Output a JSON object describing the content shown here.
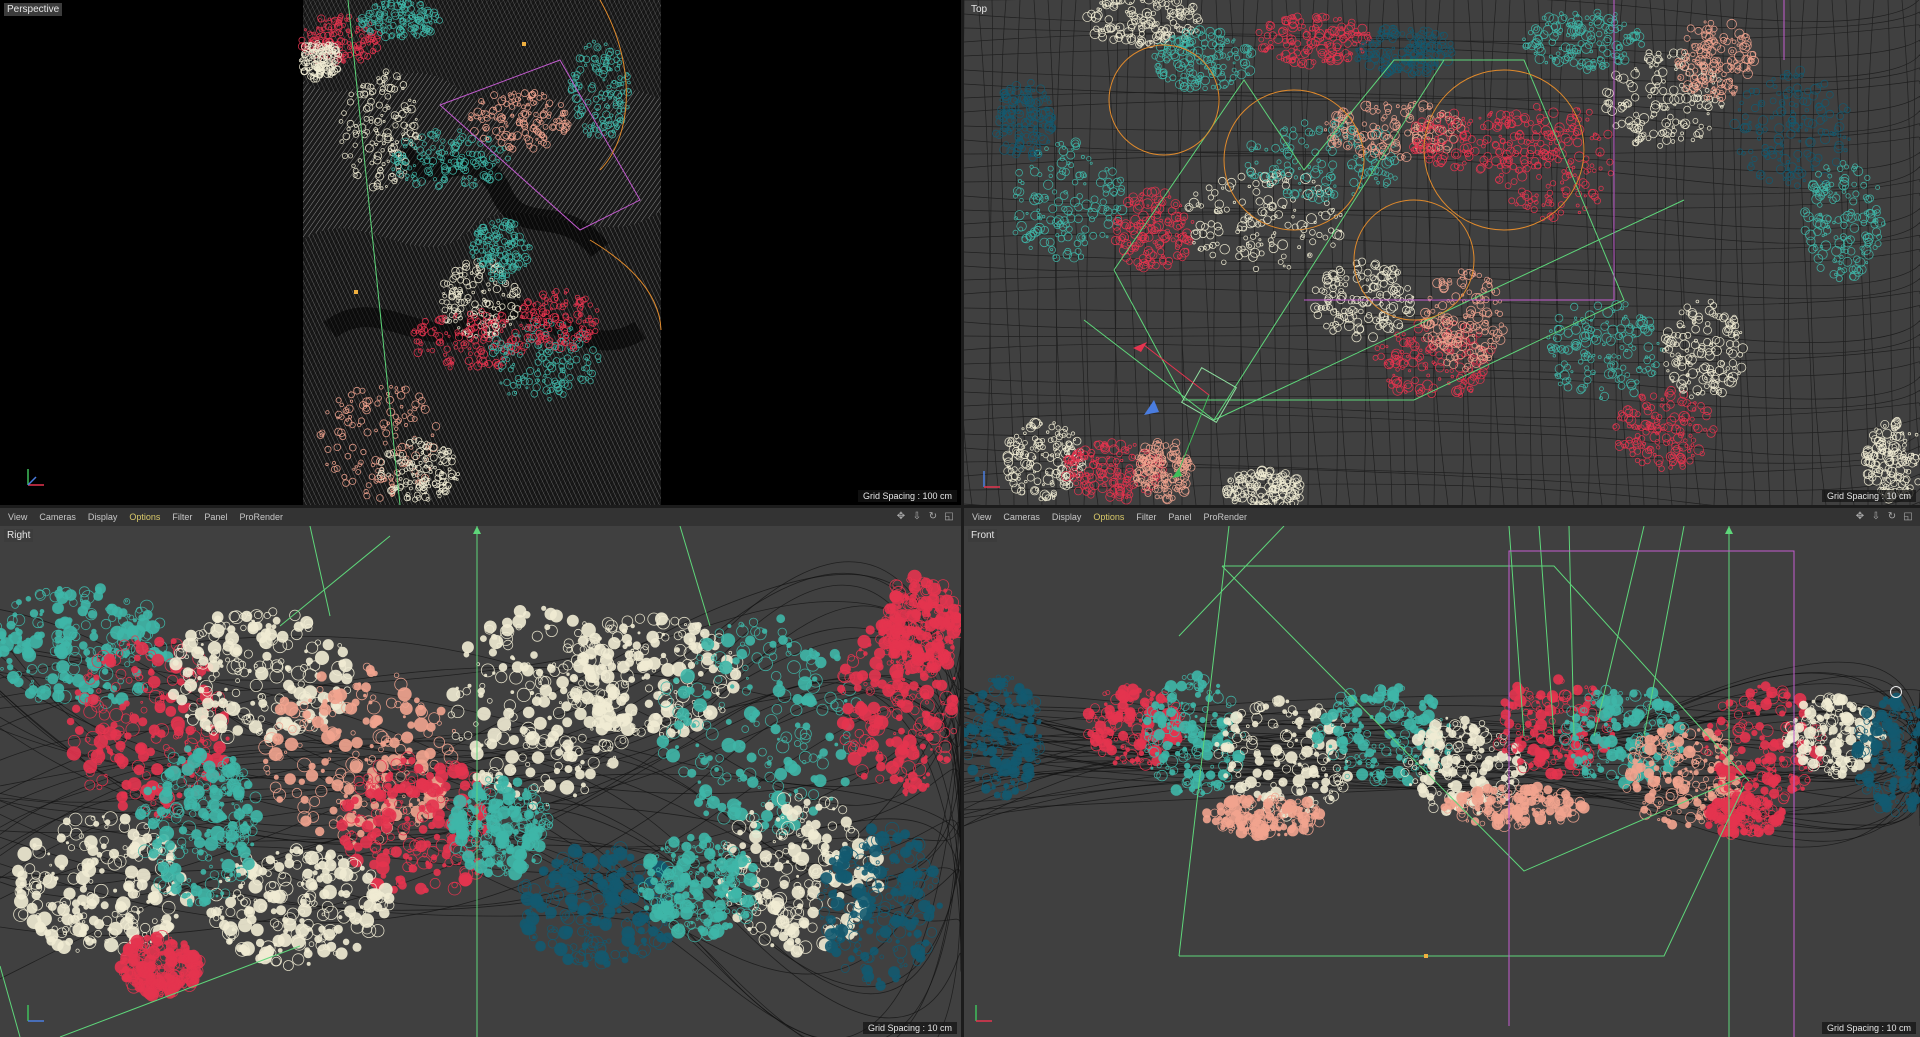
{
  "viewports": {
    "perspective": {
      "label": "Perspective",
      "grid": "Grid Spacing : 100 cm"
    },
    "top": {
      "label": "Top",
      "grid": "Grid Spacing : 10 cm"
    },
    "right": {
      "label": "Right",
      "grid": "Grid Spacing : 10 cm"
    },
    "front": {
      "label": "Front",
      "grid": "Grid Spacing : 10 cm"
    }
  },
  "menu": {
    "items": [
      "View",
      "Cameras",
      "Display",
      "Options",
      "Filter",
      "Panel",
      "ProRender"
    ],
    "active": "Options"
  },
  "icons": [
    "move-icon",
    "zoom-icon",
    "rotate-icon",
    "maximize-icon",
    "crosshair-icon"
  ],
  "colors": {
    "red": "#e5344f",
    "teal": "#3fb7a9",
    "dark_teal": "#135a70",
    "peach": "#f2a48f",
    "cream": "#f1ecd4",
    "black_mesh": "#111111",
    "green_line": "#5ed67a",
    "magenta_line": "#c35bd0",
    "orange_line": "#e08a2c",
    "bg": "#404040"
  }
}
